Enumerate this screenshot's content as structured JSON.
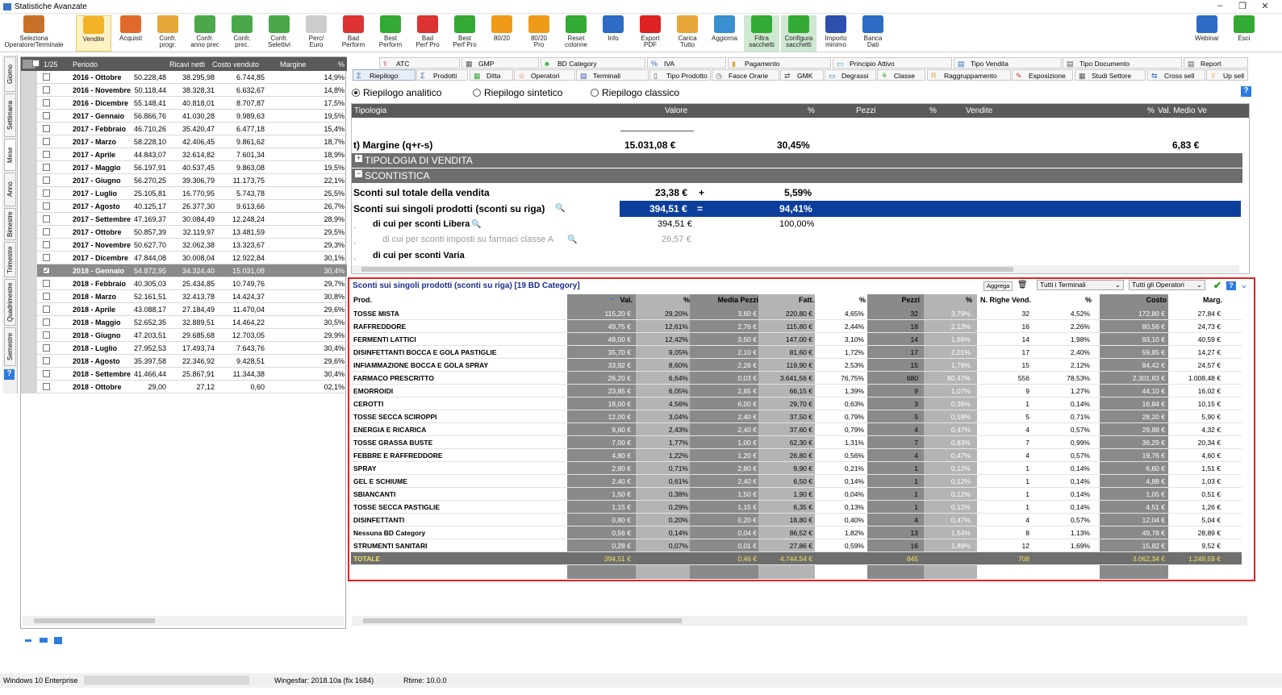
{
  "window": {
    "title": "Statistiche Avanzate",
    "minimize": "–",
    "restore": "❐",
    "close": "✕"
  },
  "ribbon": [
    {
      "label": "Seleziona\nOperatore/Terminale",
      "color": "#c87028"
    },
    {
      "label": "Vendite",
      "color": "#f3b327"
    },
    {
      "label": "Acquisti",
      "color": "#e06a2b"
    },
    {
      "label": "Confr.\nprogr.",
      "color": "#e8a53a"
    },
    {
      "label": "Confr.\nanno prec",
      "color": "#4aa84a"
    },
    {
      "label": "Confr.\nprec.",
      "color": "#4aa84a"
    },
    {
      "label": "Confr.\nSelettivi",
      "color": "#4aa84a"
    },
    {
      "label": "Perc/\nEuro",
      "color": "#cccccc"
    },
    {
      "label": "Bad\nPerform",
      "color": "#d33"
    },
    {
      "label": "Best\nPerform",
      "color": "#3a3"
    },
    {
      "label": "Bad\nPerf Pro",
      "color": "#d33"
    },
    {
      "label": "Best\nPerf Pro",
      "color": "#3a3"
    },
    {
      "label": "80/20",
      "color": "#f09a1a"
    },
    {
      "label": "80/20\nPro",
      "color": "#f09a1a"
    },
    {
      "label": "Reset\ncolonne",
      "color": "#3a3"
    },
    {
      "label": "Info",
      "color": "#2d6bc4"
    },
    {
      "label": "Export\nPDF",
      "color": "#d22"
    },
    {
      "label": "Carica\nTutto",
      "color": "#e8a53a"
    },
    {
      "label": "Aggiorna",
      "color": "#3a8fd0"
    },
    {
      "label": "Filtra\nsacchetti",
      "color": "#3a3"
    },
    {
      "label": "Configura\nsacchetti",
      "color": "#3a3"
    },
    {
      "label": "Importo\nminimo",
      "color": "#2d4fb0"
    },
    {
      "label": "Banca\nDati",
      "color": "#2d6bc4"
    },
    {
      "label": "Webinar",
      "color": "#2d6bc4"
    },
    {
      "label": "Esci",
      "color": "#3a3"
    }
  ],
  "sidetabs": [
    "Giorno",
    "Settimana",
    "Mese",
    "Anno",
    "Bimestre",
    "Trimestre",
    "Quadrimestre",
    "Semestre"
  ],
  "left": {
    "header": {
      "count": "1/25",
      "period": "Periodo",
      "ricavi": "Ricavi netti",
      "costo": "Costo venduto",
      "margine": "Margine",
      "pct": "%"
    },
    "rows": [
      {
        "p": "2016 - Ottobre",
        "r": "50.228,48",
        "c": "38.295,98",
        "m": "6.744,85",
        "pc": "14,9%"
      },
      {
        "p": "2016 - Novembre",
        "r": "50.118,44",
        "c": "38.328,31",
        "m": "6.632,67",
        "pc": "14,8%"
      },
      {
        "p": "2016 - Dicembre",
        "r": "55.148,41",
        "c": "40.818,01",
        "m": "8.707,87",
        "pc": "17,5%"
      },
      {
        "p": "2017 - Gennaio",
        "r": "56.866,76",
        "c": "41.030,28",
        "m": "9.989,63",
        "pc": "19,5%"
      },
      {
        "p": "2017 - Febbraio",
        "r": "46.710,26",
        "c": "35.420,47",
        "m": "6.477,18",
        "pc": "15,4%"
      },
      {
        "p": "2017 - Marzo",
        "r": "58.228,10",
        "c": "42.406,45",
        "m": "9.861,62",
        "pc": "18,7%"
      },
      {
        "p": "2017 - Aprile",
        "r": "44.843,07",
        "c": "32.614,82",
        "m": "7.601,34",
        "pc": "18,9%"
      },
      {
        "p": "2017 - Maggio",
        "r": "56.197,91",
        "c": "40.537,45",
        "m": "9.863,08",
        "pc": "19,5%"
      },
      {
        "p": "2017 - Giugno",
        "r": "56.270,25",
        "c": "39.306,79",
        "m": "11.173,75",
        "pc": "22,1%"
      },
      {
        "p": "2017 - Luglio",
        "r": "25.105,81",
        "c": "16.770,95",
        "m": "5.743,78",
        "pc": "25,5%"
      },
      {
        "p": "2017 - Agosto",
        "r": "40.125,17",
        "c": "26.377,30",
        "m": "9.613,66",
        "pc": "26,7%"
      },
      {
        "p": "2017 - Settembre",
        "r": "47.169,37",
        "c": "30.084,49",
        "m": "12.248,24",
        "pc": "28,9%"
      },
      {
        "p": "2017 - Ottobre",
        "r": "50.857,39",
        "c": "32.119,97",
        "m": "13.481,59",
        "pc": "29,5%"
      },
      {
        "p": "2017 - Novembre",
        "r": "50.627,70",
        "c": "32.062,38",
        "m": "13.323,67",
        "pc": "29,3%"
      },
      {
        "p": "2017 - Dicembre",
        "r": "47.844,08",
        "c": "30.008,04",
        "m": "12.922,84",
        "pc": "30,1%"
      },
      {
        "p": "2018 - Gennaio",
        "r": "54.872,95",
        "c": "34.324,40",
        "m": "15.031,08",
        "pc": "30,4%",
        "sel": true
      },
      {
        "p": "2018 - Febbraio",
        "r": "40.305,03",
        "c": "25.434,85",
        "m": "10.749,76",
        "pc": "29,7%"
      },
      {
        "p": "2018 - Marzo",
        "r": "52.161,51",
        "c": "32.413,78",
        "m": "14.424,37",
        "pc": "30,8%"
      },
      {
        "p": "2018 - Aprile",
        "r": "43.088,17",
        "c": "27.184,49",
        "m": "11.470,04",
        "pc": "29,6%"
      },
      {
        "p": "2018 - Maggio",
        "r": "52.652,35",
        "c": "32.889,51",
        "m": "14.464,22",
        "pc": "30,5%"
      },
      {
        "p": "2018 - Giugno",
        "r": "47.203,51",
        "c": "29.685,68",
        "m": "12.703,05",
        "pc": "29,9%"
      },
      {
        "p": "2018 - Luglio",
        "r": "27.952,53",
        "c": "17.493,74",
        "m": "7.643,76",
        "pc": "30,4%"
      },
      {
        "p": "2018 - Agosto",
        "r": "35.397,58",
        "c": "22.346,92",
        "m": "9.428,51",
        "pc": "29,6%"
      },
      {
        "p": "2018 - Settembre",
        "r": "41.466,44",
        "c": "25.867,91",
        "m": "11.344,38",
        "pc": "30,4%"
      },
      {
        "p": "2018 - Ottobre",
        "r": "29,00",
        "c": "27,12",
        "m": "0,60",
        "pc": "02,1%"
      }
    ]
  },
  "tabs_row1": [
    {
      "label": "ATC",
      "icon": "⚕",
      "color": "#c33"
    },
    {
      "label": "GMP",
      "icon": "▦",
      "color": "#555"
    },
    {
      "label": "BD Category",
      "icon": "♣",
      "color": "#3a3"
    },
    {
      "label": "IVA",
      "icon": "%",
      "color": "#2d6bc4"
    },
    {
      "label": "Pagamento",
      "icon": "▮",
      "color": "#e8a53a"
    },
    {
      "label": "Principio Attivo",
      "icon": "▭",
      "color": "#3a8fd0"
    },
    {
      "label": "Tipo Vendita",
      "icon": "▤",
      "color": "#2d6bc4"
    },
    {
      "label": "Tipo Documento",
      "icon": "▤",
      "color": "#555"
    },
    {
      "label": "Report",
      "icon": "▤",
      "color": "#555"
    }
  ],
  "tabs_row2": [
    {
      "label": "Riepilogo",
      "icon": "Σ",
      "color": "#2d6bc4"
    },
    {
      "label": "Prodotti",
      "icon": "Σ",
      "color": "#2d6bc4"
    },
    {
      "label": "Ditta",
      "icon": "▦",
      "color": "#3a3"
    },
    {
      "label": "Operatori",
      "icon": "☺",
      "color": "#c87028"
    },
    {
      "label": "Terminali",
      "icon": "▤",
      "color": "#2d4fb0"
    },
    {
      "label": "Tipo Prodotto",
      "icon": "▯",
      "color": "#555"
    },
    {
      "label": "Fasce Orarie",
      "icon": "◷",
      "color": "#555"
    },
    {
      "label": "GMK",
      "icon": "⇄",
      "color": "#555"
    },
    {
      "label": "Degrassi",
      "icon": "▭",
      "color": "#2d6bc4"
    },
    {
      "label": "Classe",
      "icon": "⚘",
      "color": "#3a3"
    },
    {
      "label": "Raggruppamento",
      "icon": "R",
      "color": "#e8a53a"
    },
    {
      "label": "Esposizione",
      "icon": "✎",
      "color": "#c33"
    },
    {
      "label": "Studi Settore",
      "icon": "▦",
      "color": "#555"
    },
    {
      "label": "Cross sell",
      "icon": "⇆",
      "color": "#2d6bc4"
    },
    {
      "label": "Up sell",
      "icon": "⇧",
      "color": "#e8a53a"
    }
  ],
  "radios": {
    "r1": "Riepilogo analitico",
    "r2": "Riepilogo sintetico",
    "r3": "Riepilogo classico"
  },
  "upper": {
    "headers": {
      "tip": "Tipologia",
      "val": "Valore",
      "pct": "%",
      "pez": "Pezzi",
      "pct2": "%",
      "ven": "Vendite",
      "pct3": "%",
      "vmv": "Val. Medio Ve"
    },
    "margine": {
      "label": "t) Margine (q+r-s)",
      "val": "15.031,08 €",
      "pct": "30,45%",
      "vmv": "6,83 €"
    },
    "g1": "TIPOLOGIA DI VENDITA",
    "g2": "SCONTISTICA",
    "s1": {
      "label": "Sconti sul totale della vendita",
      "val": "23,38 €",
      "op": "+",
      "pct": "5,59%"
    },
    "s2": {
      "label": "Sconti sui singoli prodotti (sconti su riga)",
      "val": "394,51 €",
      "op": "=",
      "pct": "94,41%"
    },
    "s3": {
      "label": "di cui per sconti Libera",
      "val": "394,51 €",
      "pct": "100,00%"
    },
    "s4": {
      "label": "di cui per sconti imposti su farmaci classe A",
      "val": "26,57 €"
    },
    "s5": {
      "label": "di cui per sconti Varia"
    }
  },
  "detail": {
    "title": "Sconti sui singoli prodotti (sconti su riga) [19 BD Category]",
    "aggrega": "Aggrega",
    "terminali": "Tutti i Terminali",
    "operatori": "Tutti gli Operatori",
    "headers": {
      "prod": "Prod.",
      "val": "Val.",
      "pct": "%",
      "mp": "Media Pezzi",
      "fatt": "Fatt.",
      "pct2": "%",
      "pez": "Pezzi",
      "pct3": "%",
      "nrv": "N. Righe Vend.",
      "pct4": "%",
      "costo": "Costo",
      "marg": "Marg."
    },
    "rows": [
      [
        "TOSSE MISTA",
        "115,20 €",
        "29,20%",
        "3,60 €",
        "220,80 €",
        "4,65%",
        "32",
        "3,79%",
        "32",
        "4,52%",
        "172,80 €",
        "27,84 €"
      ],
      [
        "RAFFREDDORE",
        "49,75 €",
        "12,61%",
        "2,76 €",
        "115,80 €",
        "2,44%",
        "18",
        "2,13%",
        "16",
        "2,26%",
        "80,56 €",
        "24,73 €"
      ],
      [
        "FERMENTI LATTICI",
        "49,00 €",
        "12,42%",
        "3,50 €",
        "147,00 €",
        "3,10%",
        "14",
        "1,66%",
        "14",
        "1,98%",
        "93,10 €",
        "40,59 €"
      ],
      [
        "DISINFETTANTI BOCCA E GOLA PASTIGLIE",
        "35,70 €",
        "9,05%",
        "2,10 €",
        "81,60 €",
        "1,72%",
        "17",
        "2,01%",
        "17",
        "2,40%",
        "59,85 €",
        "14,27 €"
      ],
      [
        "INFIAMMAZIONE BOCCA E GOLA SPRAY",
        "33,92 €",
        "8,60%",
        "2,26 €",
        "119,90 €",
        "2,53%",
        "15",
        "1,78%",
        "15",
        "2,12%",
        "84,42 €",
        "24,57 €"
      ],
      [
        "FARMACO PRESCRITTO",
        "26,20 €",
        "6,64%",
        "0,03 €",
        "3.641,56 €",
        "76,75%",
        "680",
        "80,47%",
        "556",
        "78,53%",
        "2.301,83 €",
        "1.008,48 €"
      ],
      [
        "EMORROIDI",
        "23,85 €",
        "6,05%",
        "2,65 €",
        "66,15 €",
        "1,39%",
        "9",
        "1,07%",
        "9",
        "1,27%",
        "44,10 €",
        "16,02 €"
      ],
      [
        "CEROTTI",
        "18,00 €",
        "4,56%",
        "6,00 €",
        "29,70 €",
        "0,63%",
        "3",
        "0,36%",
        "1",
        "0,14%",
        "16,84 €",
        "10,15 €"
      ],
      [
        "TOSSE SECCA SCIROPPI",
        "12,00 €",
        "3,04%",
        "2,40 €",
        "37,50 €",
        "0,79%",
        "5",
        "0,59%",
        "5",
        "0,71%",
        "28,20 €",
        "5,90 €"
      ],
      [
        "ENERGIA E RICARICA",
        "9,60 €",
        "2,43%",
        "2,40 €",
        "37,60 €",
        "0,79%",
        "4",
        "0,47%",
        "4",
        "0,57%",
        "29,88 €",
        "4,32 €"
      ],
      [
        "TOSSE GRASSA BUSTE",
        "7,00 €",
        "1,77%",
        "1,00 €",
        "62,30 €",
        "1,31%",
        "7",
        "0,83%",
        "7",
        "0,99%",
        "36,29 €",
        "20,34 €"
      ],
      [
        "FEBBRE E RAFFREDDORE",
        "4,80 €",
        "1,22%",
        "1,20 €",
        "26,80 €",
        "0,56%",
        "4",
        "0,47%",
        "4",
        "0,57%",
        "19,76 €",
        "4,60 €"
      ],
      [
        "SPRAY",
        "2,80 €",
        "0,71%",
        "2,80 €",
        "9,90 €",
        "0,21%",
        "1",
        "0,12%",
        "1",
        "0,14%",
        "6,60 €",
        "1,51 €"
      ],
      [
        "GEL E SCHIUME",
        "2,40 €",
        "0,61%",
        "2,40 €",
        "6,50 €",
        "0,14%",
        "1",
        "0,12%",
        "1",
        "0,14%",
        "4,88 €",
        "1,03 €"
      ],
      [
        "SBIANCANTI",
        "1,50 €",
        "0,38%",
        "1,50 €",
        "1,90 €",
        "0,04%",
        "1",
        "0,12%",
        "1",
        "0,14%",
        "1,05 €",
        "0,51 €"
      ],
      [
        "TOSSE SECCA PASTIGLIE",
        "1,15 €",
        "0,29%",
        "1,15 €",
        "6,35 €",
        "0,13%",
        "1",
        "0,12%",
        "1",
        "0,14%",
        "4,51 €",
        "1,26 €"
      ],
      [
        "DISINFETTANTI",
        "0,80 €",
        "0,20%",
        "0,20 €",
        "18,80 €",
        "0,40%",
        "4",
        "0,47%",
        "4",
        "0,57%",
        "12,04 €",
        "5,04 €"
      ],
      [
        "Nessuna BD Category",
        "0,56 €",
        "0,14%",
        "0,04 €",
        "86,52 €",
        "1,82%",
        "13",
        "1,54%",
        "8",
        "1,13%",
        "49,78 €",
        "28,89 €"
      ],
      [
        "STRUMENTI SANITARI",
        "0,28 €",
        "0,07%",
        "0,01 €",
        "27,86 €",
        "0,59%",
        "16",
        "1,89%",
        "12",
        "1,69%",
        "15,82 €",
        "9,52 €"
      ]
    ],
    "total": [
      "TOTALE",
      "394,51 €",
      "",
      "0,46 €",
      "4.744,54 €",
      "",
      "845",
      "",
      "708",
      "",
      "3.062,34 €",
      "1.249,59 €"
    ]
  },
  "status": {
    "os": "Windows 10 Enterprise",
    "ver": "Wingesfar: 2018.10a (fix 1684)",
    "rtime": "Rtime: 10.0.0"
  }
}
